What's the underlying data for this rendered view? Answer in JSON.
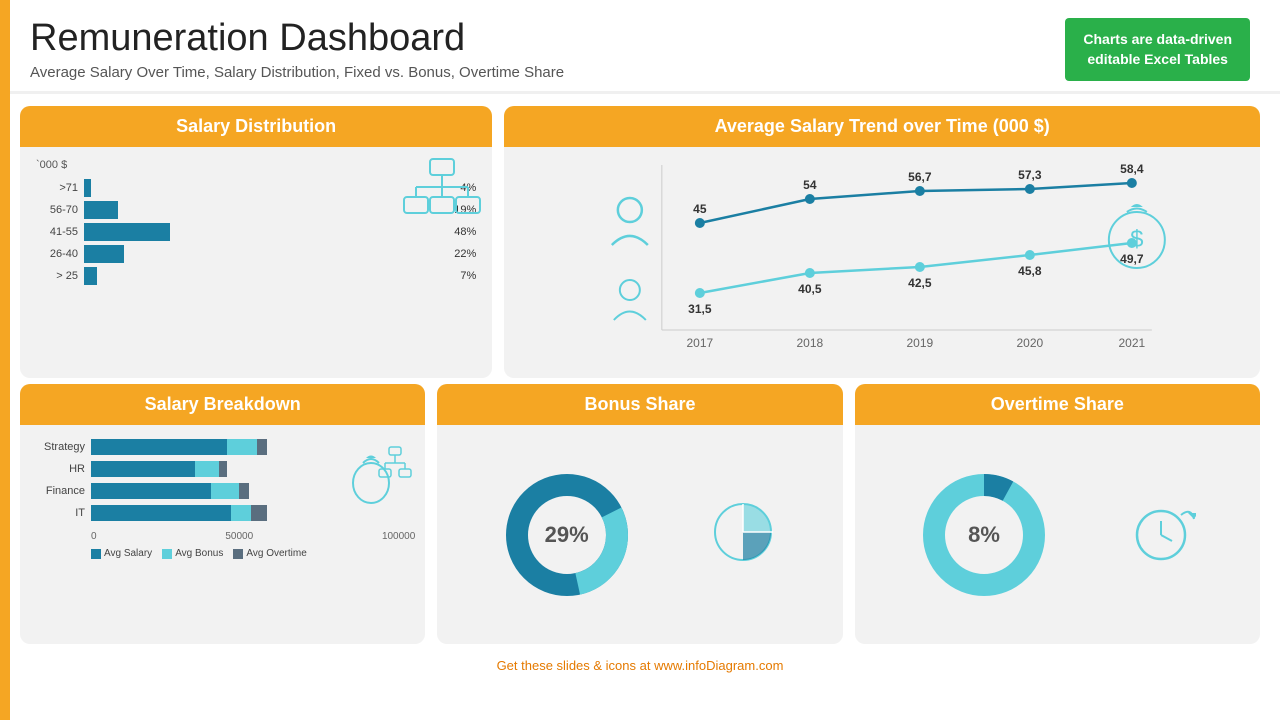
{
  "header": {
    "title": "Remuneration Dashboard",
    "subtitle": "Average Salary Over Time, Salary Distribution,  Fixed vs. Bonus, Overtime Share",
    "badge_line1": "Charts are data-driven",
    "badge_line2": "editable Excel Tables"
  },
  "salary_distribution": {
    "panel_title": "Salary Distribution",
    "unit_label": "`000 $",
    "bars": [
      {
        "label": ">71",
        "pct": 4,
        "pct_label": "4%"
      },
      {
        "label": "56-70",
        "pct": 19,
        "pct_label": "19%"
      },
      {
        "label": "41-55",
        "pct": 48,
        "pct_label": "48%"
      },
      {
        "label": "26-40",
        "pct": 22,
        "pct_label": "22%"
      },
      {
        "label": "> 25",
        "pct": 7,
        "pct_label": "7%"
      }
    ]
  },
  "trend_chart": {
    "panel_title": "Average Salary Trend over Time (000 $)",
    "years": [
      "2017",
      "2018",
      "2019",
      "2020",
      "2021"
    ],
    "senior": [
      45,
      54,
      56.7,
      57.3,
      58.4
    ],
    "junior": [
      31.5,
      40.5,
      42.5,
      45.8,
      49.7
    ],
    "accent_color": "#1b7fa3",
    "light_color": "#5ecfdb"
  },
  "salary_breakdown": {
    "panel_title": "Salary Breakdown",
    "rows": [
      {
        "label": "Strategy",
        "salary": 68,
        "bonus": 15,
        "overtime": 5
      },
      {
        "label": "HR",
        "salary": 52,
        "bonus": 12,
        "overtime": 4
      },
      {
        "label": "Finance",
        "salary": 60,
        "bonus": 14,
        "overtime": 5
      },
      {
        "label": "IT",
        "salary": 70,
        "bonus": 10,
        "overtime": 8
      }
    ],
    "axis": [
      "0",
      "50000",
      "100000"
    ],
    "legend": [
      {
        "label": "Avg Salary",
        "color": "#1b7fa3"
      },
      {
        "label": "Avg Bonus",
        "color": "#5ecfdb"
      },
      {
        "label": "Avg Overtime",
        "color": "#5a6e7f"
      }
    ]
  },
  "bonus_share": {
    "panel_title": "Bonus Share",
    "value": "29%",
    "pct": 29,
    "color_main": "#1b7fa3",
    "color_light": "#5ecfdb"
  },
  "overtime_share": {
    "panel_title": "Overtime Share",
    "value": "8%",
    "pct": 8,
    "color_main": "#1b7fa3",
    "color_light": "#5ecfdb"
  },
  "footer": {
    "text": "Get these slides & icons at www.",
    "brand": "infoDiagram",
    "suffix": ".com"
  }
}
